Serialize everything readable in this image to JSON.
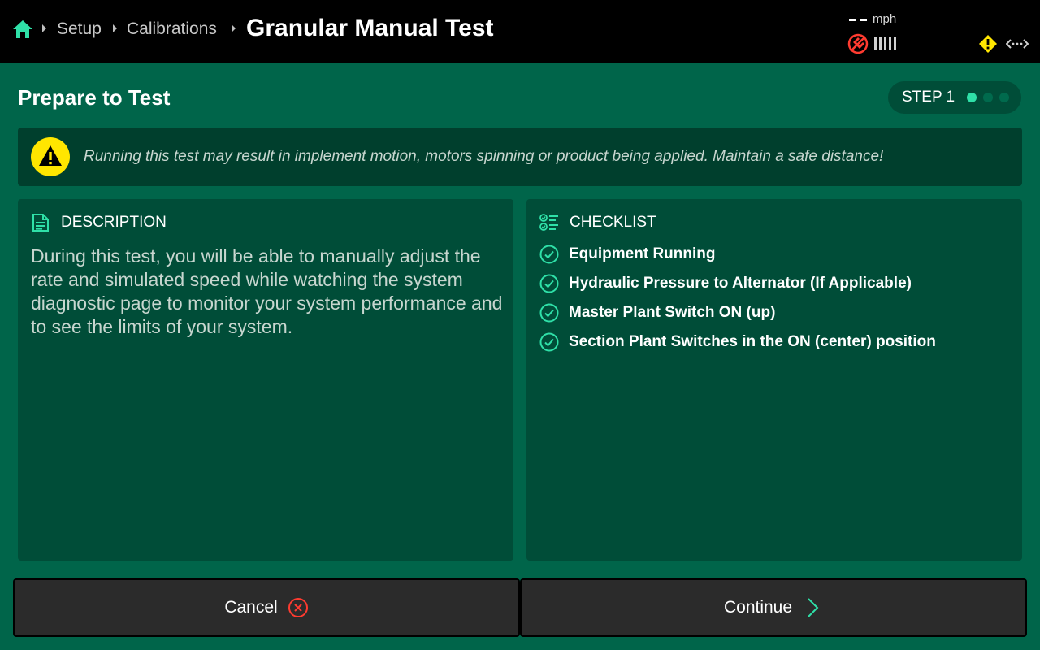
{
  "topbar": {
    "breadcrumbs": [
      "Setup",
      "Calibrations"
    ],
    "title": "Granular Manual Test",
    "speed_value": "--",
    "speed_unit": "mph",
    "icons": [
      "home-icon",
      "gps-alert-icon",
      "signal-bars-icon",
      "warning-icon",
      "connection-icon"
    ]
  },
  "header": {
    "title": "Prepare to Test",
    "step_label": "STEP 1",
    "step_current": 1,
    "step_total": 3
  },
  "warning": {
    "text": "Running this test may result in implement motion, motors spinning or product being applied. Maintain a safe distance!"
  },
  "description": {
    "heading": "DESCRIPTION",
    "body": "During this test, you will be able to manually adjust the rate and simulated speed while watching the system diagnostic page to monitor your system performance and to see the limits of your system."
  },
  "checklist": {
    "heading": "CHECKLIST",
    "items": [
      "Equipment Running",
      "Hydraulic Pressure to Alternator (If Applicable)",
      "Master Plant Switch ON (up)",
      "Section Plant Switches in the ON (center) position"
    ]
  },
  "actions": {
    "cancel_label": "Cancel",
    "continue_label": "Continue"
  },
  "colors": {
    "background": "#00654a",
    "panel": "#004d38",
    "banner": "#003f2d",
    "accent": "#2fe0a8",
    "warning": "#ffe600",
    "alert": "#ff3b30"
  }
}
